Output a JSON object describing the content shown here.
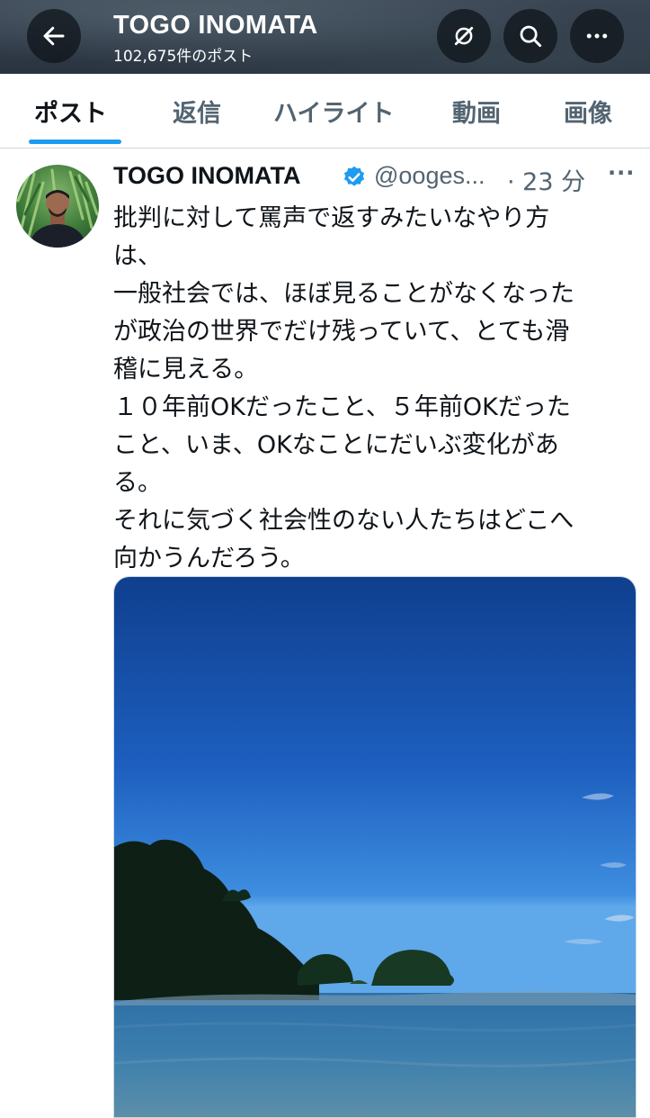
{
  "header": {
    "title": "TOGO INOMATA",
    "subtitle": "102,675件のポスト",
    "back_icon": "arrow-left-icon",
    "sync_icon": "grok-sync-icon",
    "search_icon": "search-icon",
    "more_icon": "ellipsis-icon"
  },
  "tabs": [
    {
      "label": "ポスト",
      "active": true
    },
    {
      "label": "返信"
    },
    {
      "label": "ハイライト"
    },
    {
      "label": "動画"
    },
    {
      "label": "画像"
    }
  ],
  "colors": {
    "accent": "#1d9bf0",
    "text": "#0f1419",
    "secondary": "#536471"
  },
  "post": {
    "author": "TOGO INOMATA",
    "verified": true,
    "handle": "@ooges...",
    "time": "· 23 分",
    "more_label": "···",
    "text": "批判に対して罵声で返すみたいなやり方\nは、\n一般社会では、ほぼ見ることがなくなった\nが政治の世界でだけ残っていて、とても滑\n稽に見える。\n１０年前OKだったこと、５年前OKだった\nこと、いま、OKなことにだいぶ変化があ\nる。\nそれに気づく社会性のない人たちはどこへ\n向かうんだろう。",
    "media": "photo"
  }
}
